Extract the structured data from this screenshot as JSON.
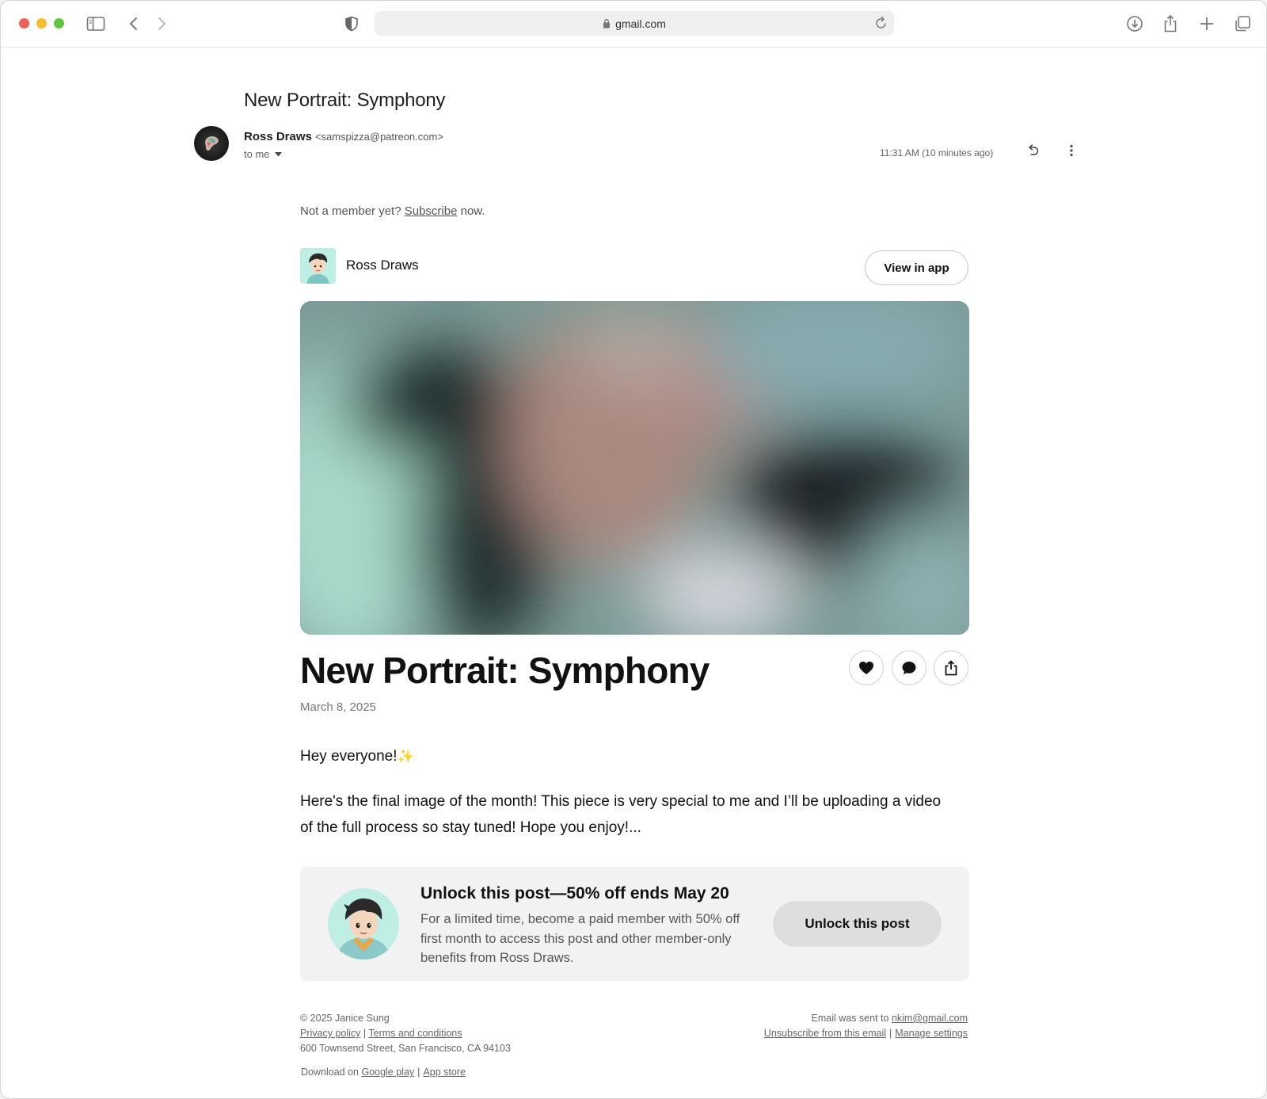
{
  "browser": {
    "url": "gmail.com"
  },
  "email": {
    "subject": "New Portrait:  Symphony",
    "sender_name": "Ross Draws",
    "sender_email": "<samspizza@patreon.com>",
    "recipient": "to me",
    "timestamp": "11:31 AM (10 minutes ago)"
  },
  "body": {
    "not_member_prefix": "Not a member yet?",
    "subscribe_link": "Subscribe",
    "not_member_suffix": "now.",
    "creator_name": "Ross Draws",
    "view_in_app": "View in app",
    "post_title": "New Portrait:  Symphony",
    "post_date": "March 8, 2025",
    "greeting": "Hey everyone!",
    "greeting_emoji": "✨",
    "paragraph": "Here's the final image of the month! This piece is very special to me and I’ll be uploading a video of the full process so stay tuned! Hope you enjoy!..."
  },
  "unlock": {
    "title": "Unlock this post—50% off ends May 20",
    "description": "For a limited time, become a paid member with 50% off first month to access this post and other member-only benefits from Ross Draws.",
    "button": "Unlock this post"
  },
  "footer": {
    "copyright": "© 2025 Janice Sung",
    "privacy": "Privacy policy",
    "terms": "Terms and conditions",
    "address": "600 Townsend Street, San Francisco, CA 94103",
    "download_prefix": "Download on",
    "google_play": "Google play",
    "app_store": "App store",
    "sent_to_prefix": "Email was sent to",
    "sent_to_email": "nkim@gmail.com",
    "unsubscribe": "Unsubscribe from this email",
    "manage": "Manage settings"
  },
  "icons": {
    "traffic_lights": [
      "close",
      "minimize",
      "zoom"
    ],
    "toolbar": [
      "sidebar-icon",
      "back-icon",
      "forward-icon",
      "shield-icon",
      "lock-icon",
      "reload-icon",
      "download-icon",
      "share-icon",
      "new-tab-icon",
      "tabs-overview-icon"
    ],
    "email": [
      "reply-icon",
      "more-vert-icon"
    ],
    "post_actions": [
      "heart-icon",
      "comment-icon",
      "share-icon"
    ]
  },
  "colors": {
    "close": "#ee5f57",
    "minimize": "#f6be2f",
    "zoom": "#5fc43f",
    "card_bg": "#f2f2f2",
    "avatar_bg": "#bfeee4"
  }
}
